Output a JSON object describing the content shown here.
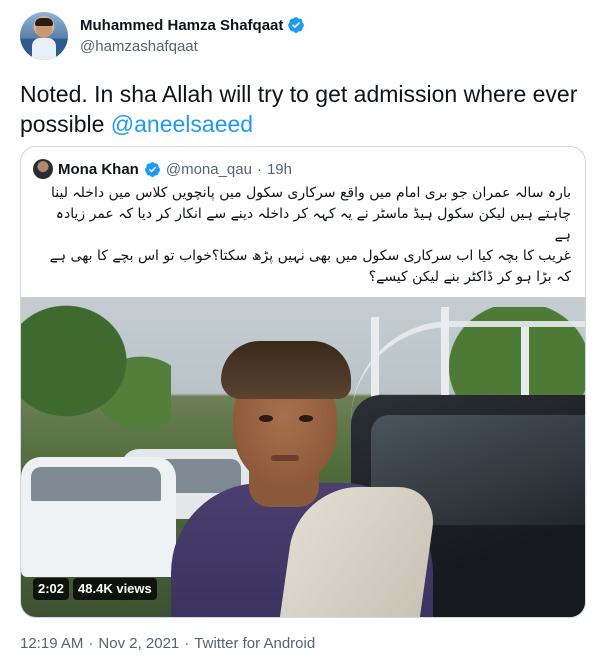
{
  "author": {
    "display_name": "Muhammed Hamza Shafqaat",
    "handle": "@hamzashafqaat",
    "verified": true,
    "avatar_icon": "profile-photo"
  },
  "tweet": {
    "text_prefix": "Noted. In sha Allah will try to get admission where ever possible ",
    "mention": "@aneelsaeed"
  },
  "quoted_tweet": {
    "display_name": "Mona Khan",
    "handle": "@mona_qau",
    "separator": "·",
    "time": "19h",
    "verified": true,
    "body": "بارہ سالہ عمران جو بری امام میں واقع سرکاری سکول میں پانچویں کلاس میں داخلہ لینا چاہتے ہیں لیکن سکول ہیڈ ماسٹر نے یہ کہہ کر داخلہ دینے سے انکار کر دیا کہ عمر زیادہ ہے\nغریب کا بچہ کیا اب سرکاری سکول میں بھی نہیں پڑھ سکتا؟خواب تو اس بچے کا بھی ہے کہ بڑا ہو کر ڈاکٹر بنے لیکن کیسے؟",
    "video": {
      "duration": "2:02",
      "views": "48.4K views"
    }
  },
  "footer": {
    "time": "12:19 AM",
    "separator1": "·",
    "date": "Nov 2, 2021",
    "separator2": "·",
    "source": "Twitter for Android"
  },
  "colors": {
    "link": "#1d9bf0",
    "verified": "#1d9bf0",
    "secondary_text": "#536471",
    "border": "#cfd9de"
  }
}
